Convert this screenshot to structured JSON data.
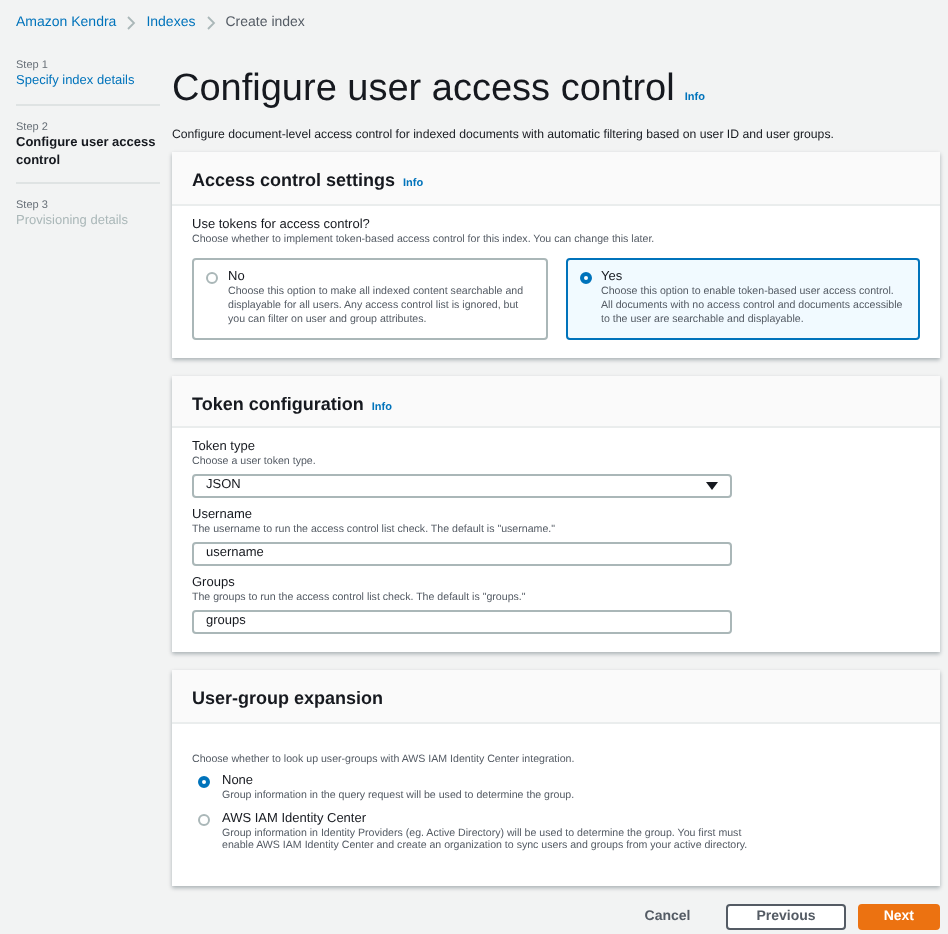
{
  "breadcrumbs": [
    {
      "label": "Amazon Kendra",
      "kind": "link"
    },
    {
      "label": "Indexes",
      "kind": "link"
    },
    {
      "label": "Create index",
      "kind": "current"
    }
  ],
  "steps": [
    {
      "step": "Step 1",
      "label": "Specify index details",
      "selected": false,
      "disabled": false
    },
    {
      "step": "Step 2",
      "label": "Configure user access control",
      "selected": true,
      "disabled": false
    },
    {
      "step": "Step 3",
      "label": "Provisioning details",
      "selected": false,
      "disabled": true
    }
  ],
  "page": {
    "title": "Configure user access control",
    "info": "Info",
    "description": "Configure document-level access control for indexed documents with automatic filtering based on user ID and user groups."
  },
  "access_control": {
    "title": "Access control settings",
    "info": "Info",
    "label": "Use tokens for access control?",
    "description": "Choose whether to implement token-based access control for this index. You can change this later.",
    "options": [
      {
        "title": "No",
        "description": "Choose this option to make all indexed content searchable and displayable for all users. Any access control list is ignored, but you can filter on user and group attributes.",
        "selected": false
      },
      {
        "title": "Yes",
        "description": "Choose this option to enable token-based user access control. All documents with no access control and documents accessible to the user are searchable and displayable.",
        "selected": true
      }
    ]
  },
  "token_configuration": {
    "title": "Token configuration",
    "info": "Info",
    "fields": [
      {
        "kind": "select",
        "label": "Token type",
        "description": "Choose a user token type.",
        "value": "JSON"
      },
      {
        "kind": "input",
        "label": "Username",
        "description": "The username to run the access control list check. The default is \"username.\"",
        "value": "username"
      },
      {
        "kind": "input",
        "label": "Groups",
        "description": "The groups to run the access control list check. The default is \"groups.\"",
        "value": "groups"
      }
    ]
  },
  "user_group_expansion": {
    "title": "User-group expansion",
    "description": "Choose whether to look up user-groups with AWS IAM Identity Center integration.",
    "options": [
      {
        "title": "None",
        "description": "Group information in the query request will be used to determine the group.",
        "selected": true
      },
      {
        "title": "AWS IAM Identity Center",
        "description": "Group information in Identity Providers (eg. Active Directory) will be used to determine the group. You first must enable AWS IAM Identity Center and create an organization to sync users and groups from your active directory.",
        "selected": false
      }
    ]
  },
  "buttons": [
    {
      "label": "Cancel",
      "kind": "link"
    },
    {
      "label": "Previous",
      "kind": "secondary"
    },
    {
      "label": "Next",
      "kind": "primary"
    }
  ]
}
